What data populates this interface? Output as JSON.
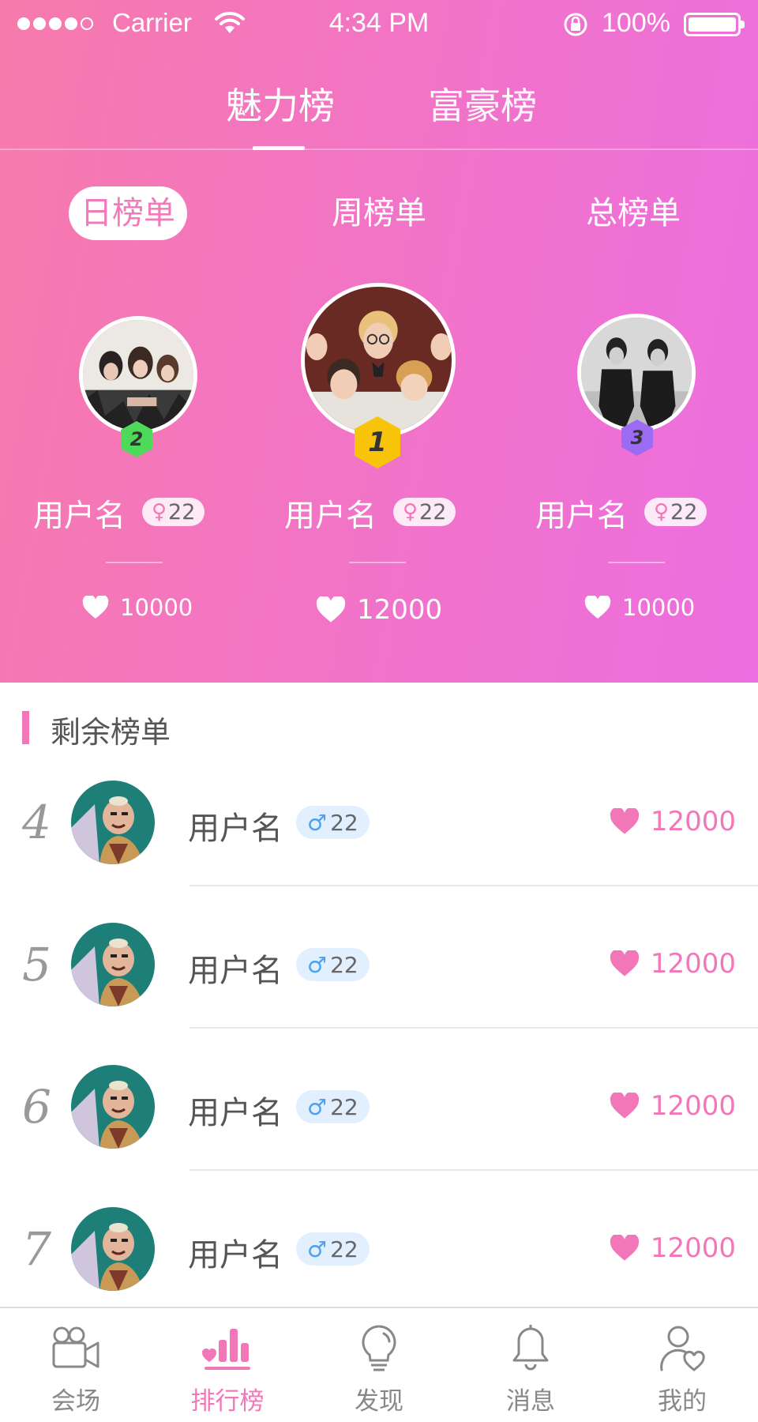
{
  "status_bar": {
    "carrier": "Carrier",
    "time": "4:34 PM",
    "battery": "100%"
  },
  "main_tabs": [
    {
      "label": "魅力榜",
      "active": true
    },
    {
      "label": "富豪榜",
      "active": false
    }
  ],
  "period_tabs": [
    {
      "label": "日榜单",
      "active": true
    },
    {
      "label": "周榜单",
      "active": false
    },
    {
      "label": "总榜单",
      "active": false
    }
  ],
  "podium": [
    {
      "rank": "2",
      "name": "用户名",
      "age": "22",
      "gender_icon": "female-icon",
      "score": "10000",
      "hex_color": "#4fd95a"
    },
    {
      "rank": "1",
      "name": "用户名",
      "age": "22",
      "gender_icon": "female-icon",
      "score": "12000",
      "hex_color": "#f7c40a"
    },
    {
      "rank": "3",
      "name": "用户名",
      "age": "22",
      "gender_icon": "female-icon",
      "score": "10000",
      "hex_color": "#9b6cf3"
    }
  ],
  "remaining": {
    "title": "剩余榜单",
    "rows": [
      {
        "rank": "4",
        "name": "用户名",
        "age": "22",
        "gender_icon": "male-icon",
        "score": "12000"
      },
      {
        "rank": "5",
        "name": "用户名",
        "age": "22",
        "gender_icon": "male-icon",
        "score": "12000"
      },
      {
        "rank": "6",
        "name": "用户名",
        "age": "22",
        "gender_icon": "male-icon",
        "score": "12000"
      },
      {
        "rank": "7",
        "name": "用户名",
        "age": "22",
        "gender_icon": "male-icon",
        "score": "12000"
      }
    ]
  },
  "tab_bar": [
    {
      "label": "会场",
      "icon": "video-camera-icon",
      "active": false
    },
    {
      "label": "排行榜",
      "icon": "ranking-bars-icon",
      "active": true
    },
    {
      "label": "发现",
      "icon": "lightbulb-icon",
      "active": false
    },
    {
      "label": "消息",
      "icon": "bell-icon",
      "active": false
    },
    {
      "label": "我的",
      "icon": "user-heart-icon",
      "active": false
    }
  ],
  "colors": {
    "accent": "#f277b8",
    "male": "#4da2ef",
    "header_start": "#f77aac",
    "header_end": "#ec6ee0"
  }
}
